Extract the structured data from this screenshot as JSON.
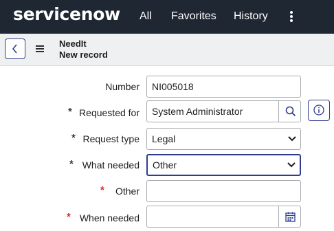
{
  "nav": {
    "logo": "servicenow",
    "items": [
      "All",
      "Favorites",
      "History"
    ]
  },
  "header": {
    "table_name": "NeedIt",
    "record_title": "New record"
  },
  "form": {
    "number": {
      "label": "Number",
      "value": "NI005018",
      "required": false
    },
    "requested_for": {
      "label": "Requested for",
      "value": "System Administrator",
      "required": true
    },
    "request_type": {
      "label": "Request type",
      "value": "Legal",
      "required": true
    },
    "what_needed": {
      "label": "What needed",
      "value": "Other",
      "required": true
    },
    "other": {
      "label": "Other",
      "value": "",
      "required": true
    },
    "when_needed": {
      "label": "When needed",
      "value": "",
      "required": true
    },
    "required_marker": "*"
  },
  "icons": {
    "more": "more-vertical-icon",
    "back": "chevron-left-icon",
    "menu": "hamburger-icon",
    "lookup": "search-icon",
    "info": "info-icon",
    "calendar": "calendar-icon",
    "dropdown": "chevron-down-icon"
  },
  "colors": {
    "topbar": "#1f2733",
    "accent": "#2e3d8f",
    "required_red": "#d6252c",
    "required_grey": "#3c3c3c",
    "header_bg": "#eef0f2"
  }
}
